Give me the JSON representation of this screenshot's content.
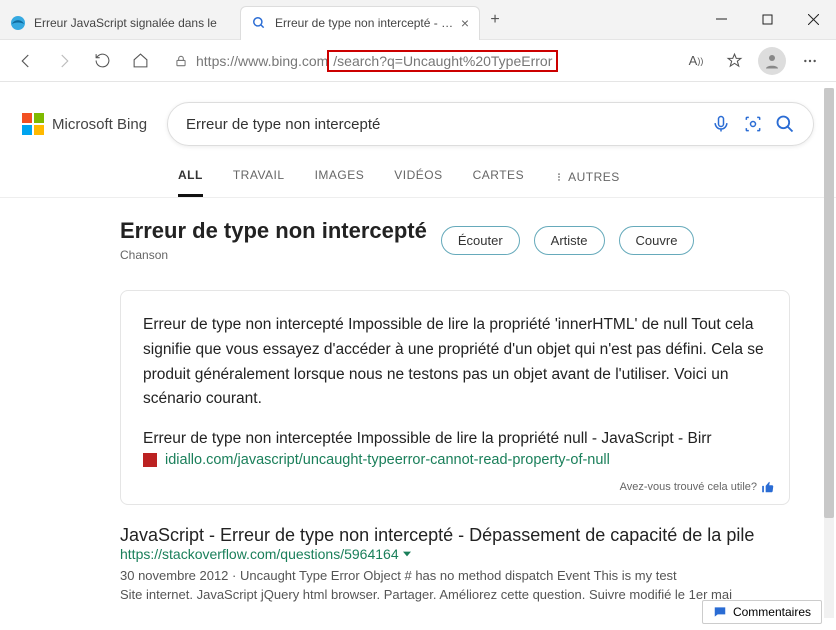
{
  "window": {
    "tabs": [
      {
        "title": "Erreur JavaScript signalée dans le",
        "active": false,
        "favicon": "edge"
      },
      {
        "title": "Erreur de type non intercepté - Recherche",
        "active": true,
        "favicon": "bing"
      }
    ]
  },
  "toolbar": {
    "url_prefix": "https://www.bing.com",
    "url_highlight": "/search?q=Uncaught%20TypeError"
  },
  "bing": {
    "brand": "Microsoft Bing",
    "query": "Erreur de type non intercepté",
    "nav": [
      "ALL",
      "TRAVAIL",
      "IMAGES",
      "VIDÉOS",
      "CARTES",
      "AUTRES"
    ],
    "heading": "Erreur de type non intercepté",
    "subtitle": "Chanson",
    "pills": [
      "Écouter",
      "Artiste",
      "Couvre"
    ],
    "answer": {
      "text": "Erreur de type non intercepté Impossible de lire la propriété 'innerHTML' de null Tout cela signifie que vous essayez d'accéder à une propriété d'un objet qui n'est pas défini. Cela se produit généralement lorsque nous ne testons pas un objet avant de l'utiliser. Voici un scénario courant.",
      "link_title": "Erreur de type non interceptée Impossible de lire la propriété null - JavaScript - Birr",
      "link_url": "idiallo.com/javascript/uncaught-typeerror-cannot-read-property-of-null",
      "feedback": "Avez-vous trouvé cela utile?"
    },
    "results": [
      {
        "title": "JavaScript - Erreur de type non intercepté - Dépassement de capacité de la pile",
        "url": "https://stackoverflow.com/questions/5964164",
        "date": "30 novembre 2012",
        "meta": "Uncaught Type Error Object # has no method dispatch Event This is my test",
        "snippet": "Site internet. JavaScript jQuery html browser. Partager. Améliorez cette question. Suivre modifié le 1er mai"
      }
    ]
  },
  "footer": {
    "comments": "Commentaires"
  }
}
